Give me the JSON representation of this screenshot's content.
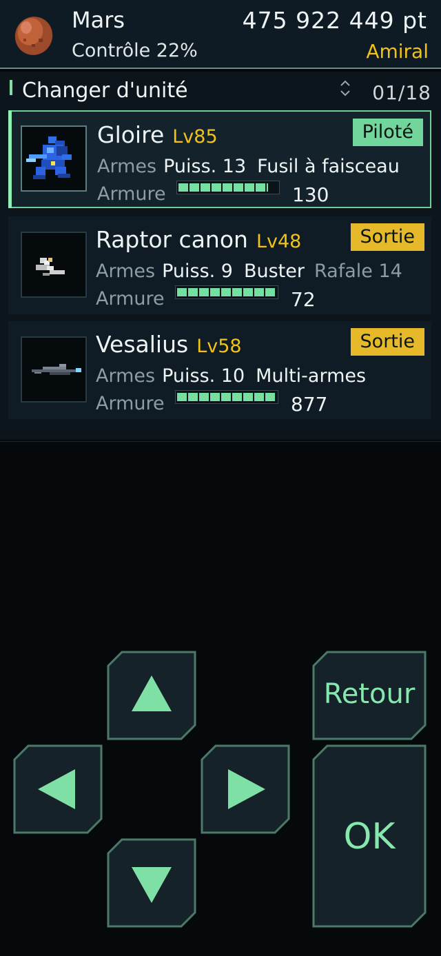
{
  "header": {
    "planet": "Mars",
    "control": "Contrôle 22%",
    "points": "475 922 449 pt",
    "rank": "Amiral",
    "planet_icon": "mars-planet-icon"
  },
  "section": {
    "title": "Changer d'unité",
    "page": "01/18",
    "scroll_icon": "up-down-chevron-icon"
  },
  "units": [
    {
      "name": "Gloire",
      "level": "Lv85",
      "status": "Piloté",
      "arms_label": "Armes",
      "power": "Puiss. 13",
      "weapon": "Fusil à faisceau",
      "weapon2": "",
      "armor_label": "Armure",
      "armor_fill": 0.9,
      "armor": "130"
    },
    {
      "name": "Raptor canon",
      "level": "Lv48",
      "status": "Sortie",
      "arms_label": "Armes",
      "power": "Puiss. 9",
      "weapon": "Buster",
      "weapon2": "Rafale 14",
      "armor_label": "Armure",
      "armor_fill": 1.0,
      "armor": "72"
    },
    {
      "name": "Vesalius",
      "level": "Lv58",
      "status": "Sortie",
      "arms_label": "Armes",
      "power": "Puiss. 10",
      "weapon": "Multi-armes",
      "weapon2": "",
      "armor_label": "Armure",
      "armor_fill": 1.0,
      "armor": "877"
    }
  ],
  "controls": {
    "back": "Retour",
    "ok": "OK",
    "up_icon": "arrow-up-icon",
    "down_icon": "arrow-down-icon",
    "left_icon": "arrow-left-icon",
    "right_icon": "arrow-right-icon"
  },
  "colors": {
    "accent_green": "#85e9ad",
    "gold": "#f0c21a",
    "background": "#05090c"
  }
}
